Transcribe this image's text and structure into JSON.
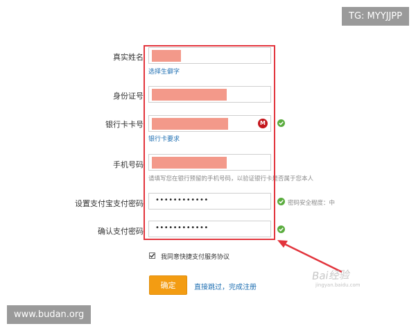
{
  "form": {
    "real_name_label": "真实姓名",
    "rare_char_link": "选择生僻字",
    "id_label": "身份证号",
    "bank_card_label": "银行卡卡号",
    "bank_req_link": "银行卡要求",
    "phone_label": "手机号码",
    "phone_hint": "请填写您在银行预留的手机号码，以验证银行卡是否属于您本人",
    "pay_pwd_label": "设置支付宝支付密码",
    "pay_pwd_value": "••••••••••••",
    "pwd_strength": "密码安全程度：中",
    "confirm_pwd_label": "确认支付密码",
    "confirm_pwd_value": "••••••••••••",
    "agree_text": "我同意快捷支付服务协议",
    "confirm_button": "确定",
    "skip_link": "直接跳过，完成注册"
  },
  "watermarks": {
    "top_right": "TG: MYYJJPP",
    "bottom_left": "www.budan.org",
    "baidu": "Bai经验",
    "baidu_sub": "jingyan.baidu.com"
  },
  "colors": {
    "highlight": "#e2343c",
    "redaction": "#f3998a",
    "link": "#1f6fb2",
    "button": "#f39c12",
    "check": "#5aac3e"
  },
  "icons": {
    "bank": "bank-logo-icon",
    "valid": "check-circle-icon"
  }
}
